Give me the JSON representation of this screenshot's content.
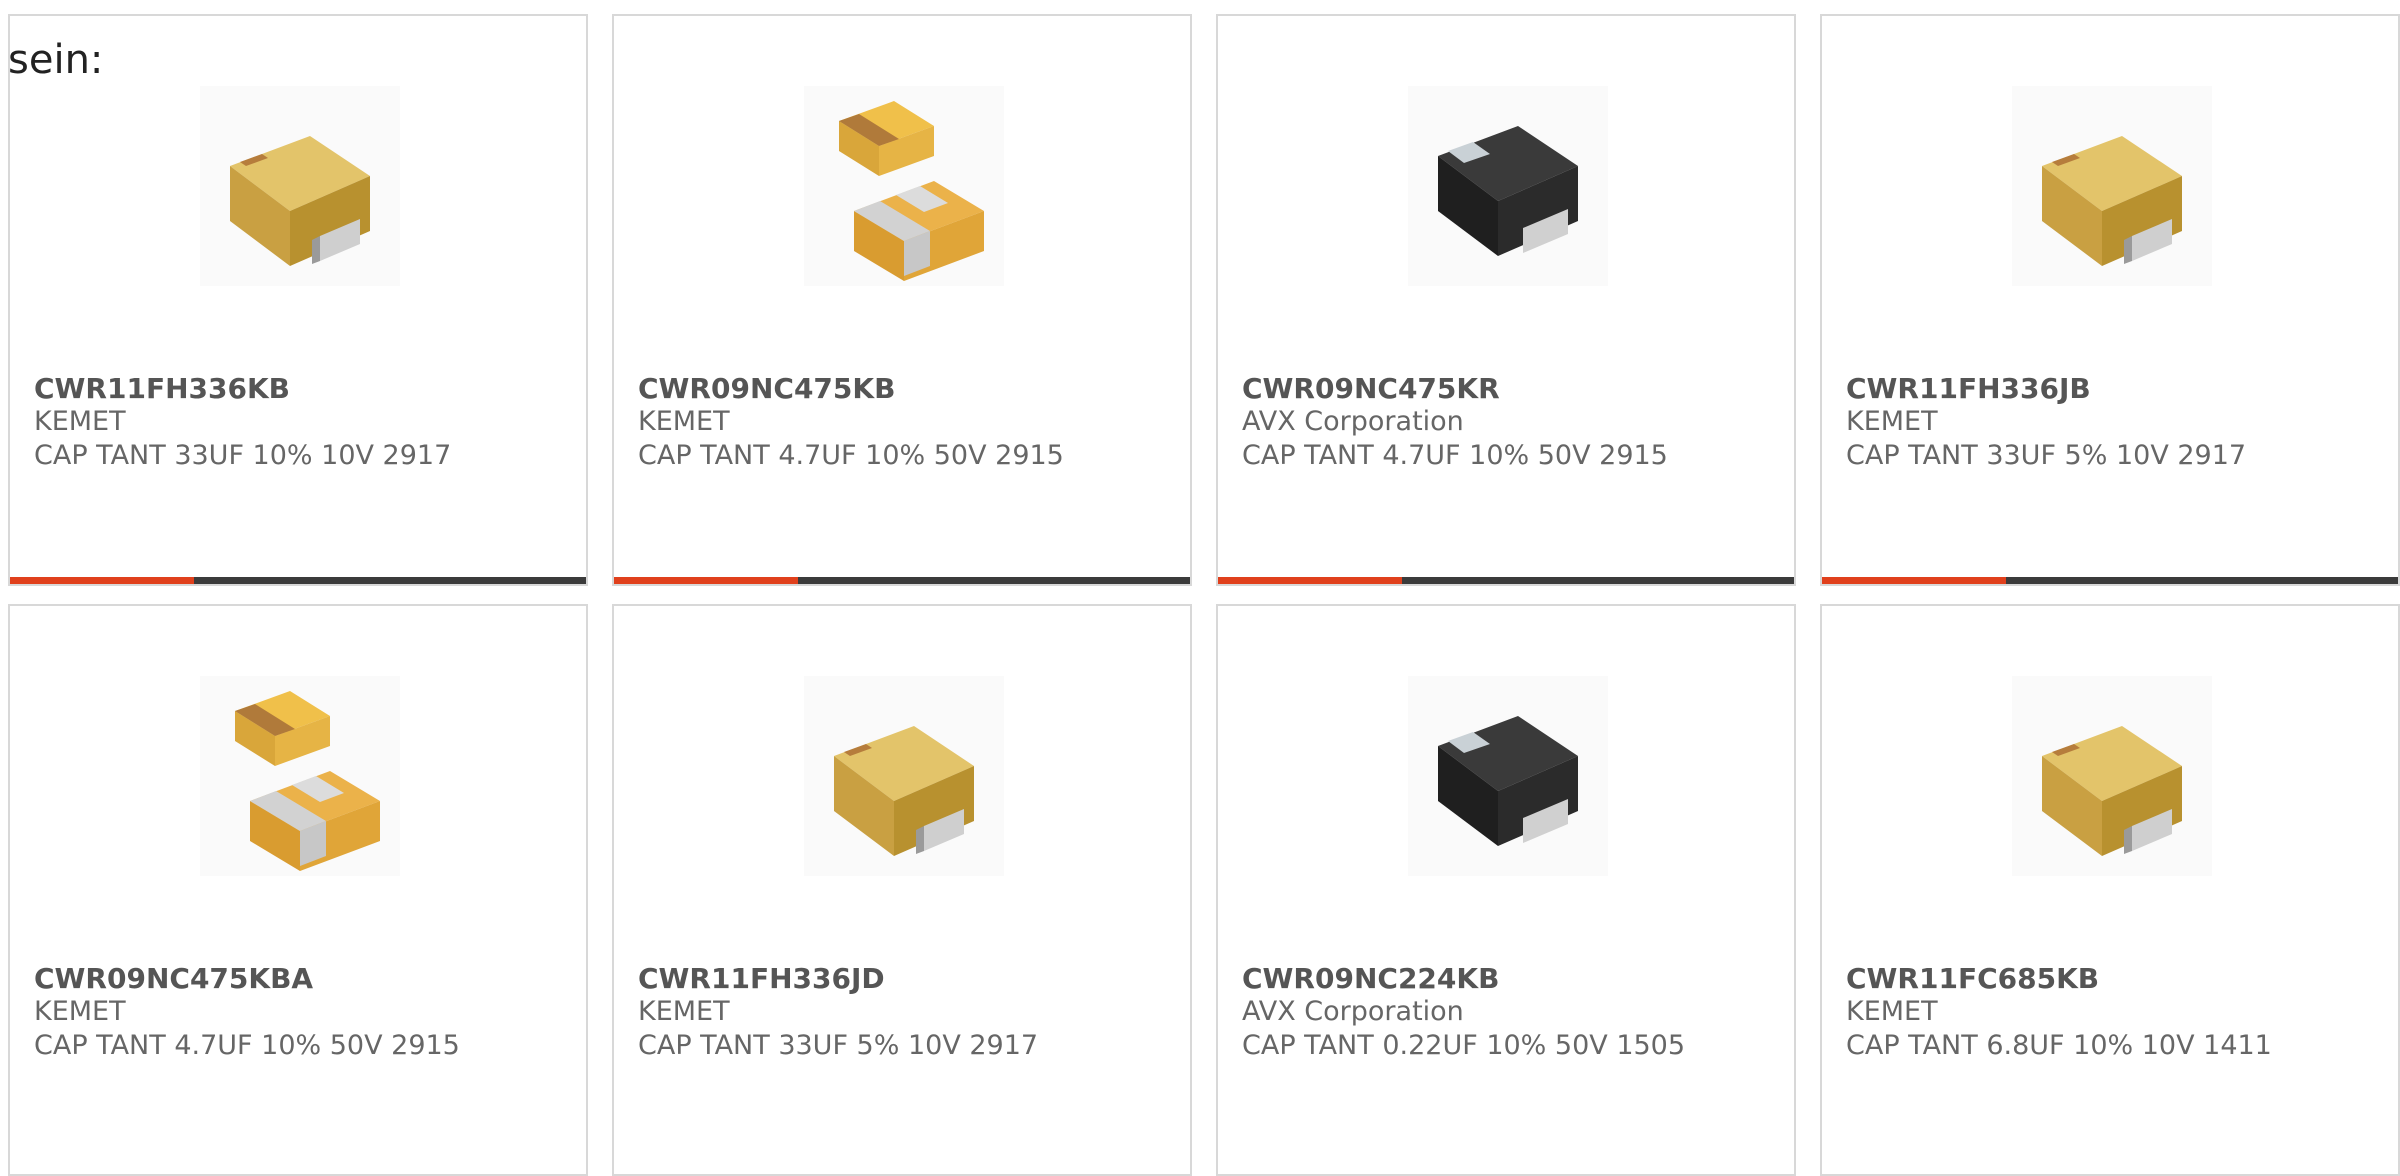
{
  "heading": "sein:",
  "accent_color": "#e0401c",
  "track_color": "#3b3b3b",
  "cards": [
    {
      "part": "CWR11FH336KB",
      "manufacturer": "KEMET",
      "description": "CAP TANT 33UF 10% 10V 2917",
      "image": "tan-chip-icon",
      "progress": 0.32
    },
    {
      "part": "CWR09NC475KB",
      "manufacturer": "KEMET",
      "description": "CAP TANT 4.7UF 10% 50V 2915",
      "image": "tan-chip-pair-icon",
      "progress": 0.32
    },
    {
      "part": "CWR09NC475KR",
      "manufacturer": "AVX Corporation",
      "description": "CAP TANT 4.7UF 10% 50V 2915",
      "image": "black-chip-icon",
      "progress": 0.32
    },
    {
      "part": "CWR11FH336JB",
      "manufacturer": "KEMET",
      "description": "CAP TANT 33UF 5% 10V 2917",
      "image": "tan-chip-icon",
      "progress": 0.32
    },
    {
      "part": "CWR09NC475KBA",
      "manufacturer": "KEMET",
      "description": "CAP TANT 4.7UF 10% 50V 2915",
      "image": "tan-chip-pair-icon",
      "progress": null
    },
    {
      "part": "CWR11FH336JD",
      "manufacturer": "KEMET",
      "description": "CAP TANT 33UF 5% 10V 2917",
      "image": "tan-chip-icon",
      "progress": null
    },
    {
      "part": "CWR09NC224KB",
      "manufacturer": "AVX Corporation",
      "description": "CAP TANT 0.22UF 10% 50V 1505",
      "image": "black-chip-icon",
      "progress": null
    },
    {
      "part": "CWR11FC685KB",
      "manufacturer": "KEMET",
      "description": "CAP TANT 6.8UF 10% 10V 1411",
      "image": "tan-chip-icon",
      "progress": null
    }
  ]
}
